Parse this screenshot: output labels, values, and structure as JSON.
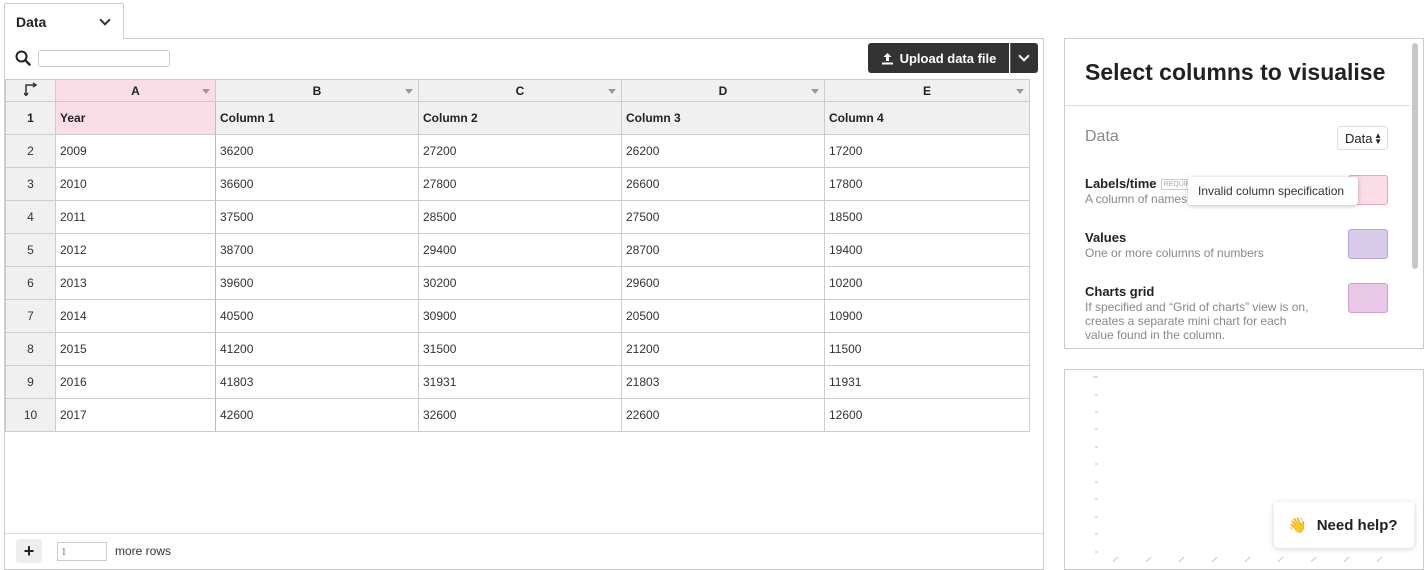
{
  "tab": {
    "label": "Data"
  },
  "toolbar": {
    "search_placeholder": "",
    "upload_label": "Upload data file"
  },
  "grid": {
    "column_letters": [
      "A",
      "B",
      "C",
      "D",
      "E"
    ],
    "header_row": {
      "num": "1",
      "cells": [
        "Year",
        "Column 1",
        "Column 2",
        "Column 3",
        "Column 4"
      ]
    },
    "rows": [
      {
        "num": "2",
        "cells": [
          "2009",
          "36200",
          "27200",
          "26200",
          "17200"
        ]
      },
      {
        "num": "3",
        "cells": [
          "2010",
          "36600",
          "27800",
          "26600",
          "17800"
        ]
      },
      {
        "num": "4",
        "cells": [
          "2011",
          "37500",
          "28500",
          "27500",
          "18500"
        ]
      },
      {
        "num": "5",
        "cells": [
          "2012",
          "38700",
          "29400",
          "28700",
          "19400"
        ]
      },
      {
        "num": "6",
        "cells": [
          "2013",
          "39600",
          "30200",
          "29600",
          "10200"
        ]
      },
      {
        "num": "7",
        "cells": [
          "2014",
          "40500",
          "30900",
          "20500",
          "10900"
        ]
      },
      {
        "num": "8",
        "cells": [
          "2015",
          "41200",
          "31500",
          "21200",
          "11500"
        ]
      },
      {
        "num": "9",
        "cells": [
          "2016",
          "41803",
          "31931",
          "21803",
          "11931"
        ]
      },
      {
        "num": "10",
        "cells": [
          "2017",
          "42600",
          "32600",
          "22600",
          "12600"
        ]
      }
    ]
  },
  "footer": {
    "add_label": "+",
    "rows_value": "1",
    "more_rows_label": "more rows"
  },
  "right_panel": {
    "title": "Select columns to visualise",
    "data_label": "Data",
    "data_select_value": "Data",
    "fields": [
      {
        "label": "Labels/time",
        "badge": "REQUIRED",
        "desc": "A column of names",
        "color": "#fbdde8"
      },
      {
        "label": "Values",
        "desc": "One or more columns of numbers",
        "color": "#d8cbea"
      },
      {
        "label": "Charts grid",
        "desc": "If specified and “Grid of charts” view is on, creates a separate mini chart for each value found in the column.",
        "color": "#e8c8e6"
      }
    ]
  },
  "tooltip": {
    "text": "Invalid column specification"
  },
  "help": {
    "emoji": "👋",
    "label": "Need help?"
  },
  "colors": {
    "accent_dark": "#333333",
    "labels_column": "#fbdde8",
    "values_column": "#d8cbea",
    "grid_column": "#e8c8e6"
  }
}
